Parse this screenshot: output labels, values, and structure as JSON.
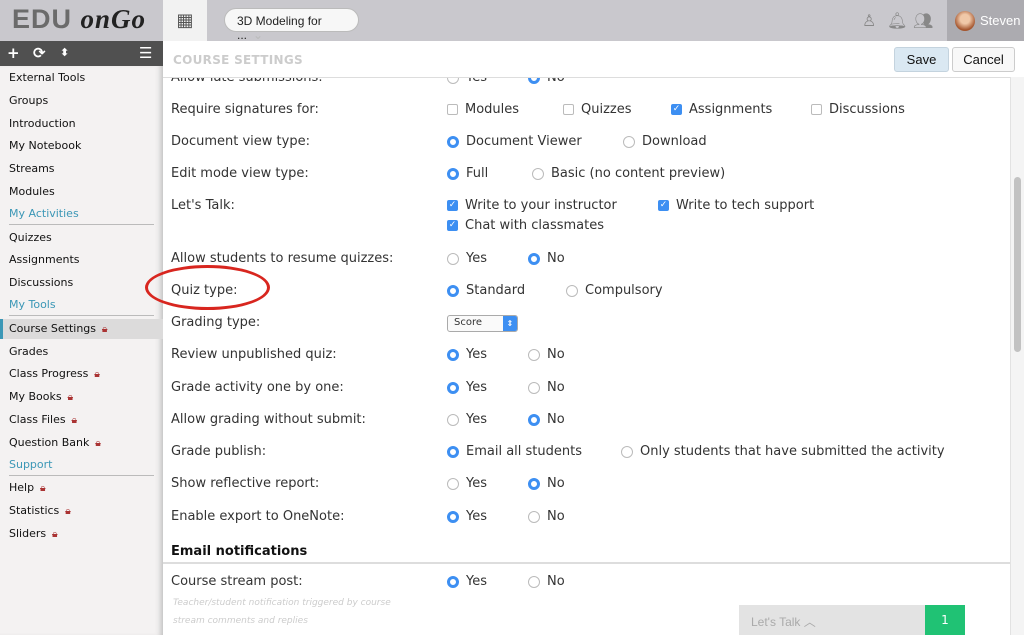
{
  "topbar": {
    "logo_text": "EDU",
    "logo_script": "onGo",
    "course": "3D Modeling for ...",
    "user": "Steven"
  },
  "sidebar": {
    "items": [
      {
        "label": "External Tools"
      },
      {
        "label": "Groups"
      },
      {
        "label": "Introduction"
      },
      {
        "label": "My Notebook"
      },
      {
        "label": "Streams"
      },
      {
        "label": "Modules"
      },
      {
        "label": "My Activities",
        "header": true
      },
      {
        "label": "Quizzes"
      },
      {
        "label": "Assignments"
      },
      {
        "label": "Discussions"
      },
      {
        "label": "My Tools",
        "header": true
      },
      {
        "label": "Course Settings",
        "lock": true,
        "active": true
      },
      {
        "label": "Grades"
      },
      {
        "label": "Class Progress",
        "lock": true
      },
      {
        "label": "My Books",
        "lock": true
      },
      {
        "label": "Class Files",
        "lock": true
      },
      {
        "label": "Question Bank",
        "lock": true
      },
      {
        "label": "Support",
        "header": true
      },
      {
        "label": "Help",
        "lock": true
      },
      {
        "label": "Statistics",
        "lock": true
      },
      {
        "label": "Sliders",
        "lock": true
      }
    ]
  },
  "main": {
    "title": "COURSE SETTINGS",
    "save": "Save",
    "cancel": "Cancel",
    "rows": [
      {
        "label": "Allow late submissions:",
        "type": "radio",
        "options": [
          {
            "label": "Yes",
            "on": false
          },
          {
            "label": "No",
            "on": true
          }
        ]
      },
      {
        "label": "Require signatures for:",
        "type": "check",
        "options": [
          {
            "label": "Modules",
            "on": false
          },
          {
            "label": "Quizzes",
            "on": false
          },
          {
            "label": "Assignments",
            "on": true
          },
          {
            "label": "Discussions",
            "on": false
          }
        ]
      },
      {
        "label": "Document view type:",
        "type": "radio",
        "options": [
          {
            "label": "Document Viewer",
            "on": true
          },
          {
            "label": "Download",
            "on": false
          }
        ]
      },
      {
        "label": "Edit mode view type:",
        "type": "radio",
        "options": [
          {
            "label": "Full",
            "on": true
          },
          {
            "label": "Basic (no content preview)",
            "on": false
          }
        ]
      },
      {
        "label": "Let's Talk:",
        "type": "check",
        "options": [
          {
            "label": "Write to your instructor",
            "on": true
          },
          {
            "label": "Write to tech support",
            "on": true
          },
          {
            "label": "Chat with classmates",
            "on": true
          }
        ]
      },
      {
        "label": "Allow students to resume quizzes:",
        "type": "radio",
        "options": [
          {
            "label": "Yes",
            "on": false
          },
          {
            "label": "No",
            "on": true
          }
        ]
      },
      {
        "label": "Quiz type:",
        "type": "radio",
        "options": [
          {
            "label": "Standard",
            "on": true
          },
          {
            "label": "Compulsory",
            "on": false
          }
        ]
      },
      {
        "label": "Grading type:",
        "type": "select",
        "value": "Score"
      },
      {
        "label": "Review unpublished quiz:",
        "type": "radio",
        "options": [
          {
            "label": "Yes",
            "on": true
          },
          {
            "label": "No",
            "on": false
          }
        ]
      },
      {
        "label": "Grade activity one by one:",
        "type": "radio",
        "options": [
          {
            "label": "Yes",
            "on": true
          },
          {
            "label": "No",
            "on": false
          }
        ]
      },
      {
        "label": "Allow grading without submit:",
        "type": "radio",
        "options": [
          {
            "label": "Yes",
            "on": false
          },
          {
            "label": "No",
            "on": true
          }
        ]
      },
      {
        "label": "Grade publish:",
        "type": "radio",
        "options": [
          {
            "label": "Email all students",
            "on": true
          },
          {
            "label": "Only students that have submitted the activity",
            "on": false
          }
        ]
      },
      {
        "label": "Show reflective report:",
        "type": "radio",
        "options": [
          {
            "label": "Yes",
            "on": false
          },
          {
            "label": "No",
            "on": true
          }
        ]
      },
      {
        "label": "Enable export to OneNote:",
        "type": "radio",
        "options": [
          {
            "label": "Yes",
            "on": true
          },
          {
            "label": "No",
            "on": false
          }
        ]
      },
      {
        "label": "Course stream post:",
        "type": "radio",
        "options": [
          {
            "label": "Yes",
            "on": true
          },
          {
            "label": "No",
            "on": false
          }
        ]
      }
    ],
    "section": "Email notifications",
    "hint": "Teacher/student notification triggered by course stream comments and replies"
  },
  "chat": {
    "label": "Let's Talk",
    "count": "1"
  },
  "colors": {
    "accent": "#3d8ff2",
    "sidebar_header": "#3b97b6",
    "badge": "#20c274",
    "annotation": "#d8261f"
  }
}
